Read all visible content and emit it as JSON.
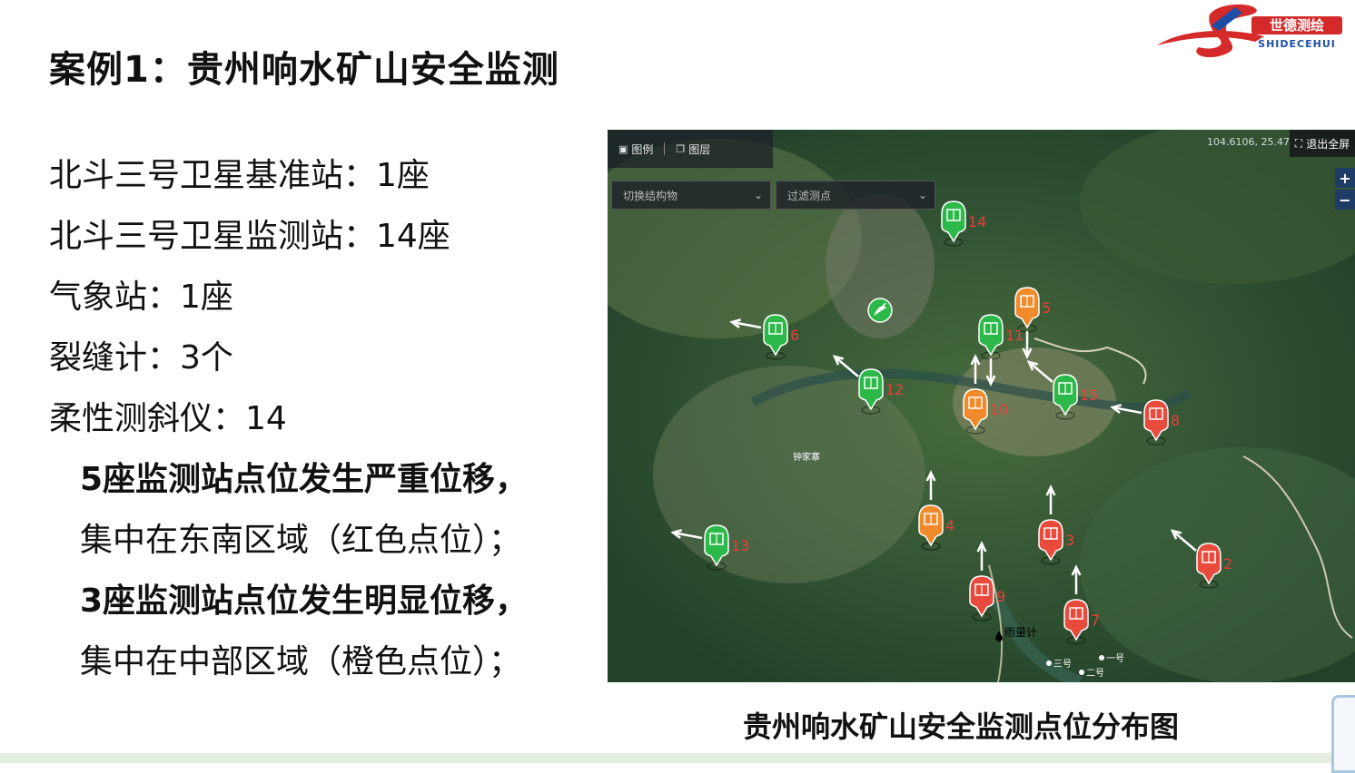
{
  "slide": {
    "title": "案例1：贵州响水矿山安全监测",
    "logo": {
      "text_cn": "世德测绘",
      "text_en": "SHIDECEHUI",
      "colors": {
        "red": "#d42a2a",
        "blue": "#1c4ea8"
      }
    },
    "items": [
      {
        "text": "北斗三号卫星基准站：1座",
        "bold": false,
        "indent": false
      },
      {
        "text": "北斗三号卫星监测站：14座",
        "bold": false,
        "indent": false
      },
      {
        "text": "气象站：1座",
        "bold": false,
        "indent": false
      },
      {
        "text": "裂缝计：3个",
        "bold": false,
        "indent": false
      },
      {
        "text": "柔性测斜仪：14",
        "bold": false,
        "indent": false
      },
      {
        "text": "5座监测站点位发生严重位移，",
        "bold": true,
        "indent": true
      },
      {
        "text": "集中在东南区域（红色点位）；",
        "bold": false,
        "indent": true
      },
      {
        "text": "3座监测站点位发生明显位移，",
        "bold": true,
        "indent": true
      },
      {
        "text": "集中在中部区域（橙色点位）；",
        "bold": false,
        "indent": true
      }
    ],
    "caption": "贵州响水矿山安全监测点位分布图"
  },
  "map": {
    "toolbar": {
      "legend_label": "图例",
      "layers_label": "图层"
    },
    "select_structure": "切换结构物",
    "select_points": "过滤测点",
    "coords": "104.6106, 25.47",
    "fullscreen_label": "退出全屏",
    "zoom_in": "+",
    "zoom_out": "−",
    "village_label": "钟家寨",
    "rain_gauge_label": "雨量计",
    "crack_labels": [
      "一号",
      "二号",
      "三号"
    ],
    "status_colors": {
      "normal": "#2db84a",
      "obvious": "#f08a2a",
      "severe": "#e84a3c"
    },
    "markers": [
      {
        "id": "14",
        "status": "normal",
        "arrow": "none"
      },
      {
        "id": "5",
        "status": "obvious",
        "arrow": "down"
      },
      {
        "id": "6",
        "status": "normal",
        "arrow": "left"
      },
      {
        "id": "11",
        "status": "normal",
        "arrow": "down"
      },
      {
        "id": "12",
        "status": "normal",
        "arrow": "up-left"
      },
      {
        "id": "10",
        "status": "obvious",
        "arrow": "up"
      },
      {
        "id": "15",
        "status": "normal",
        "arrow": "up-left"
      },
      {
        "id": "8",
        "status": "severe",
        "arrow": "left"
      },
      {
        "id": "4",
        "status": "obvious",
        "arrow": "up"
      },
      {
        "id": "3",
        "status": "severe",
        "arrow": "up"
      },
      {
        "id": "13",
        "status": "normal",
        "arrow": "left"
      },
      {
        "id": "2",
        "status": "severe",
        "arrow": "up-left"
      },
      {
        "id": "9",
        "status": "severe",
        "arrow": "up"
      },
      {
        "id": "7",
        "status": "severe",
        "arrow": "up"
      }
    ],
    "base_station_icon": "satellite-dish-icon"
  }
}
